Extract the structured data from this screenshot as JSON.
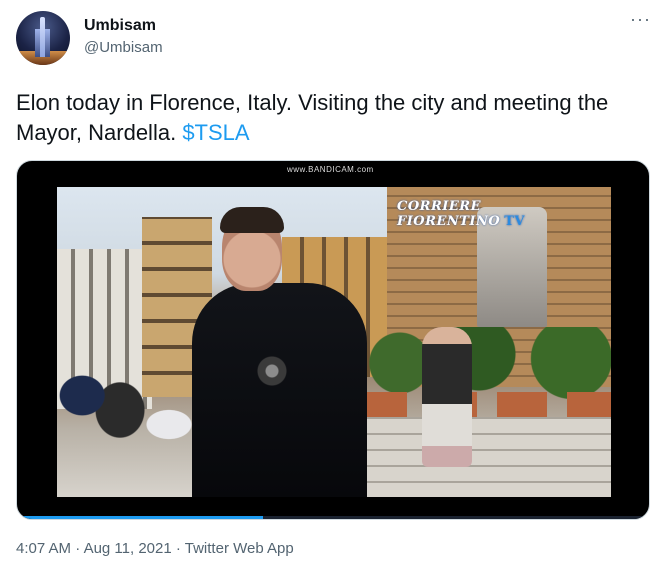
{
  "author": {
    "display_name": "Umbisam",
    "handle": "@Umbisam"
  },
  "menu": {
    "more_label": "···"
  },
  "tweet": {
    "text": "Elon today in Florence, Italy. Visiting the city and meeting the Mayor, Nardella.",
    "cashtag": "$TSLA"
  },
  "media": {
    "watermark": "www.BANDICAM.com",
    "logo_text": "CORRIERE FIORENTINO",
    "logo_suffix": "TV",
    "progress": 0.39
  },
  "footer": {
    "time": "4:07 AM",
    "sep1": " · ",
    "date": "Aug 11, 2021",
    "sep2": " · ",
    "source": "Twitter Web App"
  },
  "colors": {
    "link": "#1d9bf0",
    "secondary_text": "#536471"
  }
}
